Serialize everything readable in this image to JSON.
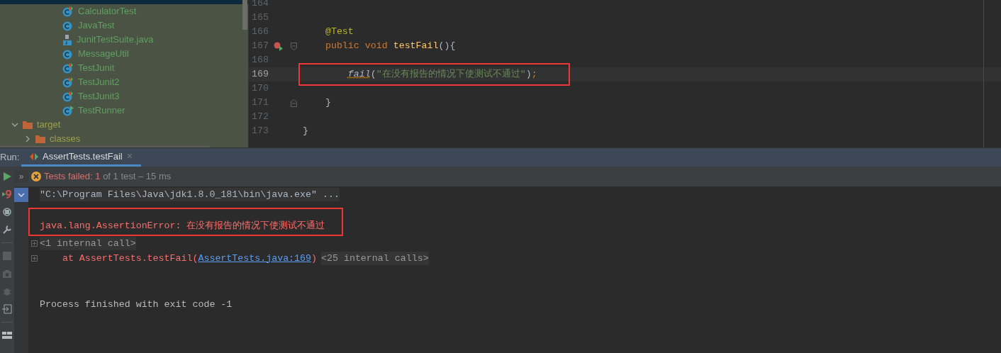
{
  "project_tree": {
    "items": [
      {
        "name": "CalculatorTest",
        "kind": "test_class"
      },
      {
        "name": "JavaTest",
        "kind": "class"
      },
      {
        "name": "JunitTestSuite.java",
        "kind": "java_file"
      },
      {
        "name": "MessageUtil",
        "kind": "class"
      },
      {
        "name": "TestJunit",
        "kind": "test_class"
      },
      {
        "name": "TestJunit2",
        "kind": "test_class"
      },
      {
        "name": "TestJunit3",
        "kind": "test_class"
      },
      {
        "name": "TestRunner",
        "kind": "runner"
      },
      {
        "name": "target",
        "kind": "folder",
        "expanded": true,
        "children": [
          {
            "name": "classes",
            "kind": "folder",
            "expanded": false
          }
        ]
      }
    ]
  },
  "editor": {
    "lines": [
      {
        "number": "164",
        "kind": "plain",
        "current": false,
        "boxed": false,
        "run_marker": false
      },
      {
        "number": "165",
        "kind": "plain",
        "current": false,
        "boxed": false,
        "run_marker": false
      },
      {
        "number": "166",
        "kind": "plain",
        "current": false,
        "boxed": false,
        "run_marker": false,
        "tokens": [
          {
            "text": "    @Test",
            "kind": "annotation"
          }
        ]
      },
      {
        "number": "167",
        "kind": "fold_open",
        "current": false,
        "boxed": false,
        "run_marker": true,
        "tokens": [
          {
            "text": "    public void ",
            "kind": "keyword"
          },
          {
            "text": "testFail",
            "kind": "method"
          },
          {
            "text": "(){",
            "kind": "plain"
          }
        ]
      },
      {
        "number": "168",
        "kind": "plain",
        "current": false,
        "boxed": false,
        "run_marker": false
      },
      {
        "number": "169",
        "kind": "plain",
        "current": true,
        "boxed": true,
        "run_marker": false,
        "tokens": [
          {
            "text": "        fail",
            "kind": "static_warning"
          },
          {
            "text": "(",
            "kind": "plain"
          },
          {
            "text": "\"在没有报告的情况下使测试不通过\"",
            "kind": "string"
          },
          {
            "text": ")",
            "kind": "plain"
          },
          {
            "text": ";",
            "kind": "keyword"
          }
        ]
      },
      {
        "number": "170",
        "kind": "plain",
        "current": false,
        "boxed": false,
        "run_marker": false
      },
      {
        "number": "171",
        "kind": "fold_close",
        "current": false,
        "boxed": false,
        "run_marker": false,
        "tokens": [
          {
            "text": "    }",
            "kind": "plain"
          }
        ]
      },
      {
        "number": "172",
        "kind": "plain",
        "current": false,
        "boxed": false,
        "run_marker": false
      },
      {
        "number": "173",
        "kind": "plain",
        "current": false,
        "boxed": false,
        "run_marker": false,
        "tokens": [
          {
            "text": "}",
            "kind": "plain"
          }
        ]
      }
    ]
  },
  "run_panel": {
    "label": "Run:",
    "tabs": [
      {
        "title": "AssertTests.testFail",
        "selected": true,
        "close": "×"
      }
    ],
    "status": {
      "expand": "»",
      "failed_label": "Tests failed:",
      "failed_count": "1",
      "rest": "of 1 test – 15 ms"
    },
    "console": [
      {
        "kind": "command",
        "boxed": false,
        "text": "\"C:\\Program Files\\Java\\jdk1.8.0_181\\bin\\java.exe\" ..."
      },
      {
        "kind": "error",
        "boxed": true,
        "text": "java.lang.AssertionError: 在没有报告的情况下使测试不通过"
      },
      {
        "kind": "folded",
        "boxed": false,
        "text": "<1 internal call>"
      },
      {
        "kind": "stack",
        "boxed": false,
        "text": "    at AssertTests.testFail(",
        "link": "AssertTests.java:169",
        "after": ")",
        "chip": "<25 internal calls>"
      },
      {
        "kind": "plain",
        "boxed": false,
        "text": "Process finished with exit code -1"
      }
    ]
  }
}
